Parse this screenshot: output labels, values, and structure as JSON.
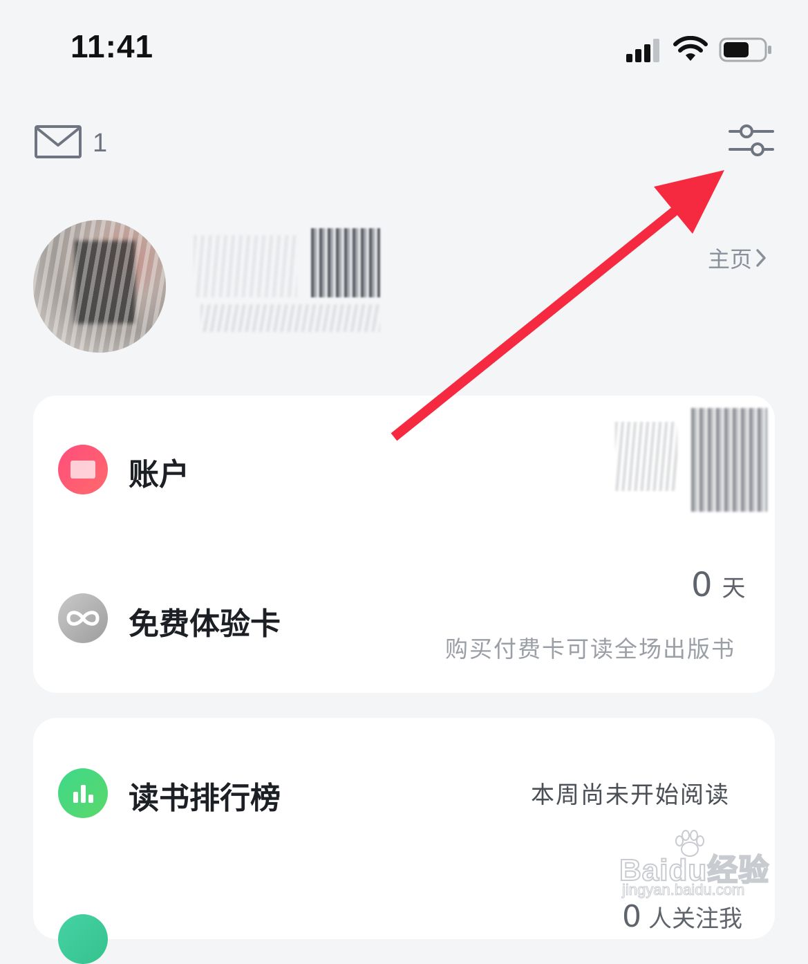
{
  "status_bar": {
    "time": "11:41"
  },
  "header": {
    "mail_count": "1"
  },
  "profile": {
    "homepage_label": "主页"
  },
  "account_card": {
    "account_label": "账户",
    "trial_card_label": "免费体验卡",
    "trial_days_value": "0",
    "trial_days_unit": "天",
    "trial_description": "购买付费卡可读全场出版书"
  },
  "ranking_card": {
    "label": "读书排行榜",
    "status": "本周尚未开始阅读",
    "followers_value": "0",
    "followers_text": "人关注我"
  },
  "watermark": {
    "main": "Baidu经验",
    "sub": "jingyan.baidu.com"
  },
  "colors": {
    "background": "#f4f5f7",
    "card": "#ffffff",
    "account_icon": "#ff5577",
    "trial_icon": "#b5b5b5",
    "ranking_icon": "#4cd67c",
    "annotation_arrow": "#f5293f"
  },
  "icons": {
    "mail": "mail-icon",
    "settings": "settings-sliders-icon",
    "trial": "infinity-icon",
    "ranking": "bar-chart-icon"
  }
}
